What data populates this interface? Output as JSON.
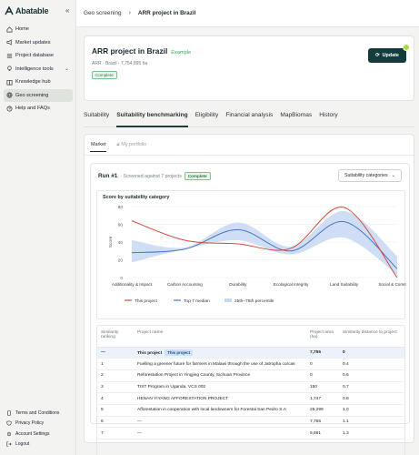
{
  "app": {
    "name": "Abatable"
  },
  "sidebar": {
    "items": [
      {
        "label": "Home",
        "icon": "home-icon"
      },
      {
        "label": "Market updates",
        "icon": "megaphone-icon"
      },
      {
        "label": "Project database",
        "icon": "list-icon"
      },
      {
        "label": "Intelligence tools",
        "icon": "bulb-icon"
      },
      {
        "label": "Knowledge hub",
        "icon": "book-icon"
      },
      {
        "label": "Geo screening",
        "icon": "globe-icon"
      },
      {
        "label": "Help and FAQs",
        "icon": "help-icon"
      }
    ],
    "footer": [
      {
        "label": "Terms and Conditions"
      },
      {
        "label": "Privacy Policy"
      },
      {
        "label": "Account Settings"
      },
      {
        "label": "Logout"
      }
    ]
  },
  "breadcrumb": {
    "parent": "Geo screening",
    "current": "ARR project in Brazil"
  },
  "project": {
    "title": "ARR project in Brazil",
    "tag": "Example",
    "subtitle": "ARR · Brazil · 7,754,895 ha",
    "status": "Complete",
    "update_label": "Update"
  },
  "tabs": [
    "Suitability",
    "Suitability benchmarking",
    "Eligibility",
    "Financial analysis",
    "MapBiomas",
    "History"
  ],
  "subtabs": [
    "Market",
    "My portfolio"
  ],
  "run": {
    "title": "Run #1",
    "subtitle": "· Screened against 7 projects",
    "status": "Complete",
    "select_value": "Suitability categories"
  },
  "chart_data": {
    "type": "line",
    "title": "Score by suitability category",
    "ylabel": "Score",
    "ylim": [
      0,
      80
    ],
    "yticks": [
      0,
      20,
      40,
      60,
      80
    ],
    "categories": [
      "Additionality & Impact",
      "Carbon Accounting",
      "Durability",
      "Ecological Integrity",
      "Land Suitability",
      "Social & Community"
    ],
    "series": [
      {
        "name": "This project",
        "color": "#d24b3a",
        "values": [
          64,
          42,
          38,
          33,
          79,
          0
        ]
      },
      {
        "name": "Top 7 median",
        "color": "#4a78c2",
        "values": [
          28,
          32,
          54,
          30,
          63,
          10
        ]
      },
      {
        "name": "25th–75th percentile",
        "color": "#c7d8f3",
        "low": [
          17,
          32,
          42,
          26,
          45,
          3
        ],
        "high": [
          42,
          34,
          62,
          35,
          75,
          24
        ]
      }
    ],
    "legend": "bottom"
  },
  "table": {
    "columns": [
      "Similarity ranking",
      "Project name",
      "Project area (ha)",
      "Similarity distance to project"
    ],
    "rows": [
      {
        "rank": "—",
        "name": "This project",
        "area": "7,755",
        "distance": "0",
        "badge": "This project",
        "highlight": true
      },
      {
        "rank": "1",
        "name": "Fuelling a greener future for farmers in Malawi through the use of Jatropha curcas",
        "area": "0",
        "distance": "0.4"
      },
      {
        "rank": "2",
        "name": "Reforestation Project in Yingjing County, Sichuan Province",
        "area": "0",
        "distance": "0.6"
      },
      {
        "rank": "3",
        "name": "TIST Program in Uganda, VCS 002",
        "area": "150",
        "distance": "0.7"
      },
      {
        "rank": "4",
        "name": "HENAN YIYANG AFFORESTATION PROJECT",
        "area": "1,747",
        "distance": "0.8"
      },
      {
        "rank": "5",
        "name": "Afforestation in cooperation with local landowners for Forestal San Pedro S.A",
        "area": "25,299",
        "distance": "1.0"
      },
      {
        "rank": "6",
        "name": "—",
        "area": "7,755",
        "distance": "1.1"
      },
      {
        "rank": "7",
        "name": "—",
        "area": "9,691",
        "distance": "1.3"
      }
    ]
  }
}
